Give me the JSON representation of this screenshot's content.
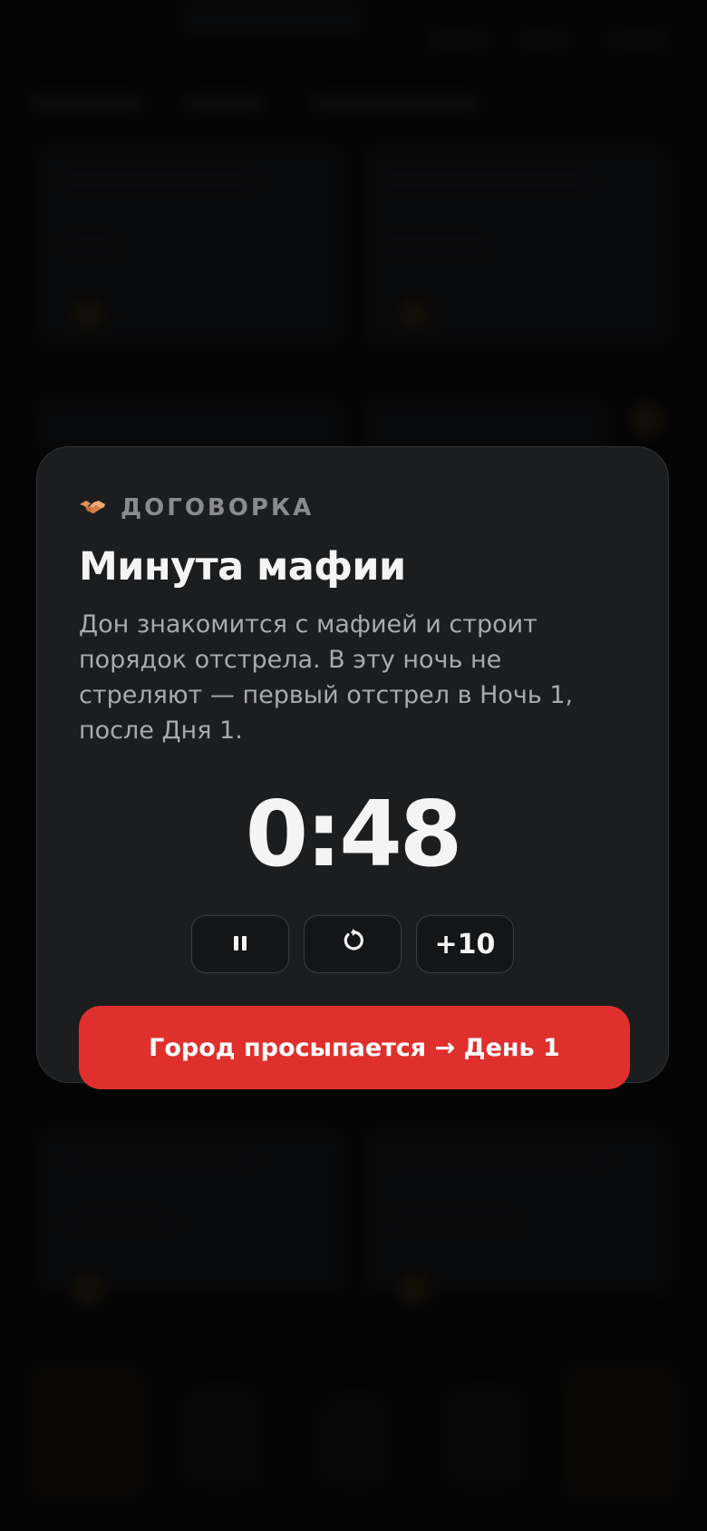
{
  "modal": {
    "eyebrow": "ДОГОВОРКА",
    "eyebrow_icon": "handshake-icon",
    "title": "Минута мафии",
    "description": "Дон знакомится с мафией и строит порядок отстрела. В эту ночь не стреляют — первый отстрел в Ночь 1, после Дня 1.",
    "timer": "0:48",
    "controls": {
      "pause_icon": "pause-icon",
      "restart_icon": "restart-icon",
      "add_label": "+10"
    },
    "primary_button": "Город просыпается → День 1"
  },
  "colors": {
    "accent": "#e0302d",
    "card": "#1c1d1f",
    "muted_text": "#a9aaae"
  }
}
